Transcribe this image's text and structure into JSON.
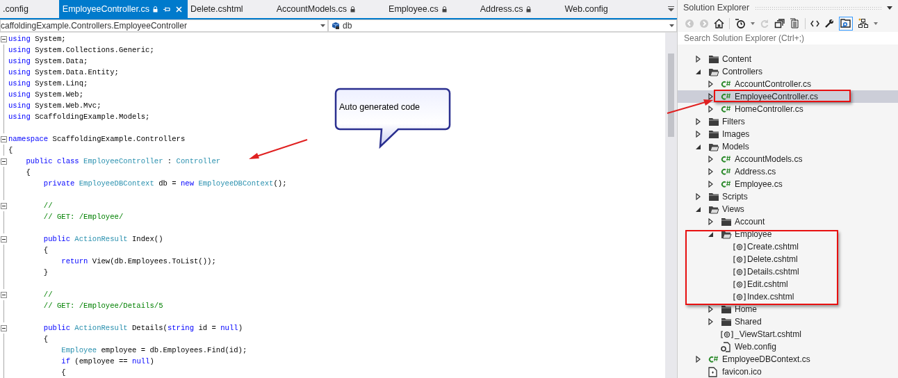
{
  "tabs": [
    {
      "label": ".config",
      "selected": false,
      "locked": false
    },
    {
      "label": "EmployeeController.cs",
      "selected": true,
      "locked": true
    },
    {
      "label": "Delete.cshtml",
      "selected": false,
      "locked": false
    },
    {
      "label": "AccountModels.cs",
      "selected": false,
      "locked": true
    },
    {
      "label": "Employee.cs",
      "selected": false,
      "locked": true
    },
    {
      "label": "Address.cs",
      "selected": false,
      "locked": true
    },
    {
      "label": "Web.config",
      "selected": false,
      "locked": false
    }
  ],
  "nav_bar": {
    "type_dropdown": "caffoldingExample.Controllers.EmployeeController",
    "member_dropdown": "db"
  },
  "code_lines": [
    {
      "fold": true,
      "tokens": [
        {
          "kind": "kw",
          "text": "using"
        },
        {
          "kind": "plain",
          "text": " System;"
        }
      ]
    },
    {
      "fold": false,
      "tokens": [
        {
          "kind": "kw",
          "text": "using"
        },
        {
          "kind": "plain",
          "text": " System.Collections.Generic;"
        }
      ]
    },
    {
      "fold": false,
      "tokens": [
        {
          "kind": "kw",
          "text": "using"
        },
        {
          "kind": "plain",
          "text": " System.Data;"
        }
      ]
    },
    {
      "fold": false,
      "tokens": [
        {
          "kind": "kw",
          "text": "using"
        },
        {
          "kind": "plain",
          "text": " System.Data.Entity;"
        }
      ]
    },
    {
      "fold": false,
      "tokens": [
        {
          "kind": "kw",
          "text": "using"
        },
        {
          "kind": "plain",
          "text": " System.Linq;"
        }
      ]
    },
    {
      "fold": false,
      "tokens": [
        {
          "kind": "kw",
          "text": "using"
        },
        {
          "kind": "plain",
          "text": " System.Web;"
        }
      ]
    },
    {
      "fold": false,
      "tokens": [
        {
          "kind": "kw",
          "text": "using"
        },
        {
          "kind": "plain",
          "text": " System.Web.Mvc;"
        }
      ]
    },
    {
      "fold": false,
      "tokens": [
        {
          "kind": "kw",
          "text": "using"
        },
        {
          "kind": "plain",
          "text": " ScaffoldingExample.Models;"
        }
      ]
    },
    {
      "fold": false
    },
    {
      "fold": true,
      "tokens": [
        {
          "kind": "kw",
          "text": "namespace"
        },
        {
          "kind": "plain",
          "text": " ScaffoldingExample.Controllers"
        }
      ]
    },
    {
      "fold": false,
      "tokens": [
        {
          "kind": "plain",
          "text": "{"
        }
      ]
    },
    {
      "fold": true,
      "tokens": [
        {
          "kind": "kw",
          "text": "    public class "
        },
        {
          "kind": "type",
          "text": "EmployeeController"
        },
        {
          "kind": "plain",
          "text": " : "
        },
        {
          "kind": "type",
          "text": "Controller"
        }
      ]
    },
    {
      "fold": false,
      "tokens": [
        {
          "kind": "plain",
          "text": "    {"
        }
      ]
    },
    {
      "fold": false,
      "tokens": [
        {
          "kind": "kw",
          "text": "        private "
        },
        {
          "kind": "type",
          "text": "EmployeeDBContext"
        },
        {
          "kind": "plain",
          "text": " db = "
        },
        {
          "kind": "kw",
          "text": "new "
        },
        {
          "kind": "type",
          "text": "EmployeeDBContext"
        },
        {
          "kind": "plain",
          "text": "();"
        }
      ]
    },
    {
      "fold": false
    },
    {
      "fold": true,
      "tokens": [
        {
          "kind": "comment",
          "text": "        //"
        }
      ]
    },
    {
      "fold": false,
      "tokens": [
        {
          "kind": "comment",
          "text": "        // GET: /Employee/"
        }
      ]
    },
    {
      "fold": false
    },
    {
      "fold": true,
      "tokens": [
        {
          "kind": "kw",
          "text": "        public "
        },
        {
          "kind": "type",
          "text": "ActionResult"
        },
        {
          "kind": "plain",
          "text": " Index()"
        }
      ]
    },
    {
      "fold": false,
      "tokens": [
        {
          "kind": "plain",
          "text": "        {"
        }
      ]
    },
    {
      "fold": false,
      "tokens": [
        {
          "kind": "kw",
          "text": "            return"
        },
        {
          "kind": "plain",
          "text": " View(db.Employees.ToList());"
        }
      ]
    },
    {
      "fold": false,
      "tokens": [
        {
          "kind": "plain",
          "text": "        }"
        }
      ]
    },
    {
      "fold": false
    },
    {
      "fold": true,
      "tokens": [
        {
          "kind": "comment",
          "text": "        //"
        }
      ]
    },
    {
      "fold": false,
      "tokens": [
        {
          "kind": "comment",
          "text": "        // GET: /Employee/Details/5"
        }
      ]
    },
    {
      "fold": false
    },
    {
      "fold": true,
      "tokens": [
        {
          "kind": "kw",
          "text": "        public "
        },
        {
          "kind": "type",
          "text": "ActionResult"
        },
        {
          "kind": "plain",
          "text": " Details("
        },
        {
          "kind": "kw",
          "text": "string"
        },
        {
          "kind": "plain",
          "text": " id = "
        },
        {
          "kind": "kw",
          "text": "null"
        },
        {
          "kind": "plain",
          "text": ")"
        }
      ]
    },
    {
      "fold": false,
      "tokens": [
        {
          "kind": "plain",
          "text": "        {"
        }
      ]
    },
    {
      "fold": false,
      "tokens": [
        {
          "kind": "type",
          "text": "            Employee"
        },
        {
          "kind": "plain",
          "text": " employee = db.Employees.Find(id);"
        }
      ]
    },
    {
      "fold": false,
      "tokens": [
        {
          "kind": "kw",
          "text": "            if"
        },
        {
          "kind": "plain",
          "text": " (employee == "
        },
        {
          "kind": "kw",
          "text": "null"
        },
        {
          "kind": "plain",
          "text": ")"
        }
      ]
    },
    {
      "fold": false,
      "tokens": [
        {
          "kind": "plain",
          "text": "            {"
        }
      ]
    }
  ],
  "callout": {
    "text": "Auto generated code"
  },
  "solution_explorer": {
    "title": "Solution Explorer",
    "search": {
      "placeholder": "Search Solution Explorer (Ctrl+;)"
    },
    "tree": [
      {
        "label": "Content",
        "kind": "folder",
        "expanded": false,
        "selected": false
      },
      {
        "label": "Controllers",
        "kind": "folder",
        "expanded": true,
        "selected": false,
        "children": [
          {
            "label": "AccountController.cs",
            "kind": "cs",
            "expanded": false,
            "selected": false
          },
          {
            "label": "EmployeeController.cs",
            "kind": "cs",
            "expanded": false,
            "selected": true
          },
          {
            "label": "HomeController.cs",
            "kind": "cs",
            "expanded": false,
            "selected": false
          }
        ]
      },
      {
        "label": "Filters",
        "kind": "folder",
        "expanded": false,
        "selected": false
      },
      {
        "label": "Images",
        "kind": "folder",
        "expanded": false,
        "selected": false
      },
      {
        "label": "Models",
        "kind": "folder",
        "expanded": true,
        "selected": false,
        "children": [
          {
            "label": "AccountModels.cs",
            "kind": "cs",
            "expanded": false,
            "selected": false
          },
          {
            "label": "Address.cs",
            "kind": "cs",
            "expanded": false,
            "selected": false
          },
          {
            "label": "Employee.cs",
            "kind": "cs",
            "expanded": false,
            "selected": false
          }
        ]
      },
      {
        "label": "Scripts",
        "kind": "folder",
        "expanded": false,
        "selected": false
      },
      {
        "label": "Views",
        "kind": "folder",
        "expanded": true,
        "selected": false,
        "children": [
          {
            "label": "Account",
            "kind": "folder",
            "expanded": false,
            "selected": false
          },
          {
            "label": "Employee",
            "kind": "folder",
            "expanded": true,
            "selected": false,
            "children": [
              {
                "label": "Create.cshtml",
                "kind": "razor",
                "selected": false
              },
              {
                "label": "Delete.cshtml",
                "kind": "razor",
                "selected": false
              },
              {
                "label": "Details.cshtml",
                "kind": "razor",
                "selected": false
              },
              {
                "label": "Edit.cshtml",
                "kind": "razor",
                "selected": false
              },
              {
                "label": "Index.cshtml",
                "kind": "razor",
                "selected": false
              }
            ]
          },
          {
            "label": "Home",
            "kind": "folder",
            "expanded": false,
            "selected": false
          },
          {
            "label": "Shared",
            "kind": "folder",
            "expanded": false,
            "selected": false
          },
          {
            "label": "_ViewStart.cshtml",
            "kind": "razor",
            "selected": false
          },
          {
            "label": "Web.config",
            "kind": "config",
            "selected": false
          }
        ]
      },
      {
        "label": "EmployeeDBContext.cs",
        "kind": "cs",
        "expanded": false,
        "selected": false
      },
      {
        "label": "favicon.ico",
        "kind": "file",
        "selected": false
      }
    ]
  }
}
